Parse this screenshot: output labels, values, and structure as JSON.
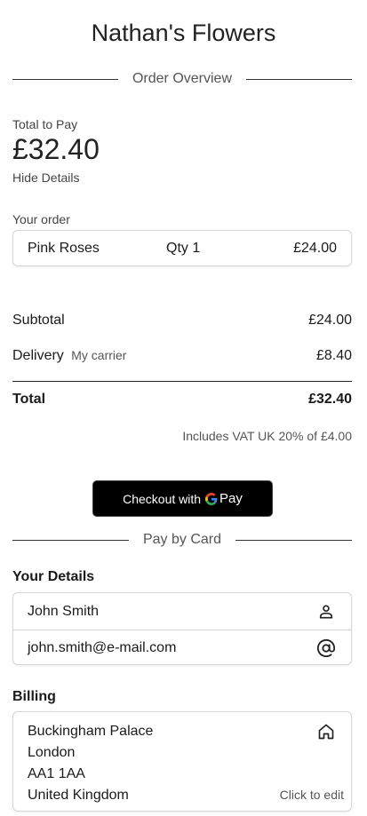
{
  "shop": {
    "title": "Nathan's Flowers"
  },
  "overview": {
    "heading": "Order Overview"
  },
  "totals": {
    "label": "Total to Pay",
    "amount": "£32.40",
    "toggle": "Hide Details"
  },
  "order": {
    "label": "Your order",
    "items": [
      {
        "name": "Pink Roses",
        "qty": "Qty 1",
        "price": "£24.00"
      }
    ]
  },
  "summary": {
    "subtotal_label": "Subtotal",
    "subtotal_value": "£24.00",
    "delivery_label": "Delivery",
    "delivery_carrier": "My carrier",
    "delivery_value": "£8.40",
    "total_label": "Total",
    "total_value": "£32.40",
    "vat_note": "Includes VAT UK 20% of £4.00"
  },
  "gpay": {
    "prefix": "Checkout with",
    "pay_word": "Pay"
  },
  "card_section": {
    "heading": "Pay by Card"
  },
  "details": {
    "heading": "Your Details",
    "name": "John Smith",
    "email": "john.smith@e-mail.com"
  },
  "billing": {
    "heading": "Billing",
    "lines": [
      "Buckingham Palace",
      "London",
      "AA1 1AA",
      "United Kingdom"
    ],
    "edit_hint": "Click to edit"
  },
  "icons": {
    "person": "person-icon",
    "at": "at-sign-icon",
    "home": "home-icon",
    "google": "google-g-icon"
  },
  "colors": {
    "gpay_background": "#000000",
    "card_border": "#d6d6d6",
    "google_blue": "#4285F4",
    "google_red": "#EA4335",
    "google_yellow": "#FBBC05",
    "google_green": "#34A853"
  }
}
